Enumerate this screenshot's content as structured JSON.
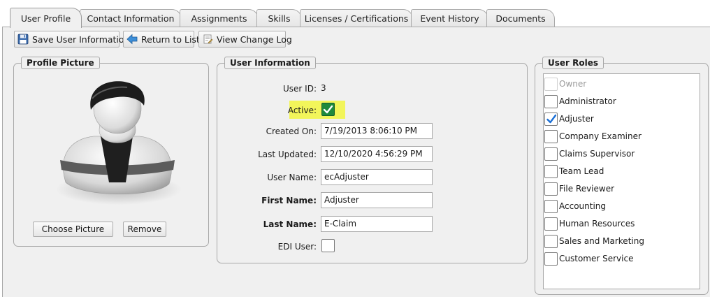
{
  "tabs": [
    {
      "label": "User Profile",
      "active": true
    },
    {
      "label": "Contact Information",
      "active": false
    },
    {
      "label": "Assignments",
      "active": false
    },
    {
      "label": "Skills",
      "active": false
    },
    {
      "label": "Licenses / Certifications",
      "active": false
    },
    {
      "label": "Event History",
      "active": false
    },
    {
      "label": "Documents",
      "active": false
    }
  ],
  "toolbar": {
    "save_label": "Save User Information",
    "return_label": "Return to List",
    "changelog_label": "View Change Log"
  },
  "profile_picture": {
    "title": "Profile Picture",
    "choose_label": "Choose Picture",
    "remove_label": "Remove"
  },
  "user_info": {
    "title": "User Information",
    "user_id_label": "User ID:",
    "user_id_value": "3",
    "active_label": "Active:",
    "active_checked": true,
    "created_label": "Created On:",
    "created_value": "7/19/2013 8:06:10 PM",
    "updated_label": "Last Updated:",
    "updated_value": "12/10/2020 4:56:29 PM",
    "username_label": "User Name:",
    "username_value": "ecAdjuster",
    "firstname_label": "First Name:",
    "firstname_value": "Adjuster",
    "lastname_label": "Last Name:",
    "lastname_value": "E-Claim",
    "edi_label": "EDI User:",
    "edi_checked": false
  },
  "user_roles": {
    "title": "User Roles",
    "roles": [
      {
        "label": "Owner",
        "checked": false,
        "disabled": true
      },
      {
        "label": "Administrator",
        "checked": false,
        "disabled": false
      },
      {
        "label": "Adjuster",
        "checked": true,
        "disabled": false
      },
      {
        "label": "Company Examiner",
        "checked": false,
        "disabled": false
      },
      {
        "label": "Claims Supervisor",
        "checked": false,
        "disabled": false
      },
      {
        "label": "Team Lead",
        "checked": false,
        "disabled": false
      },
      {
        "label": "File Reviewer",
        "checked": false,
        "disabled": false
      },
      {
        "label": "Accounting",
        "checked": false,
        "disabled": false
      },
      {
        "label": "Human Resources",
        "checked": false,
        "disabled": false
      },
      {
        "label": "Sales and Marketing",
        "checked": false,
        "disabled": false
      },
      {
        "label": "Customer Service",
        "checked": false,
        "disabled": false
      }
    ]
  },
  "colors": {
    "active_highlight": "#f2f55a",
    "active_check": "#1e8a3c",
    "role_check": "#1a6fd6"
  },
  "icons": {
    "save": "floppy-disk-icon",
    "return": "left-arrow-icon",
    "changelog": "document-log-icon",
    "avatar": "user-avatar-silhouette"
  }
}
